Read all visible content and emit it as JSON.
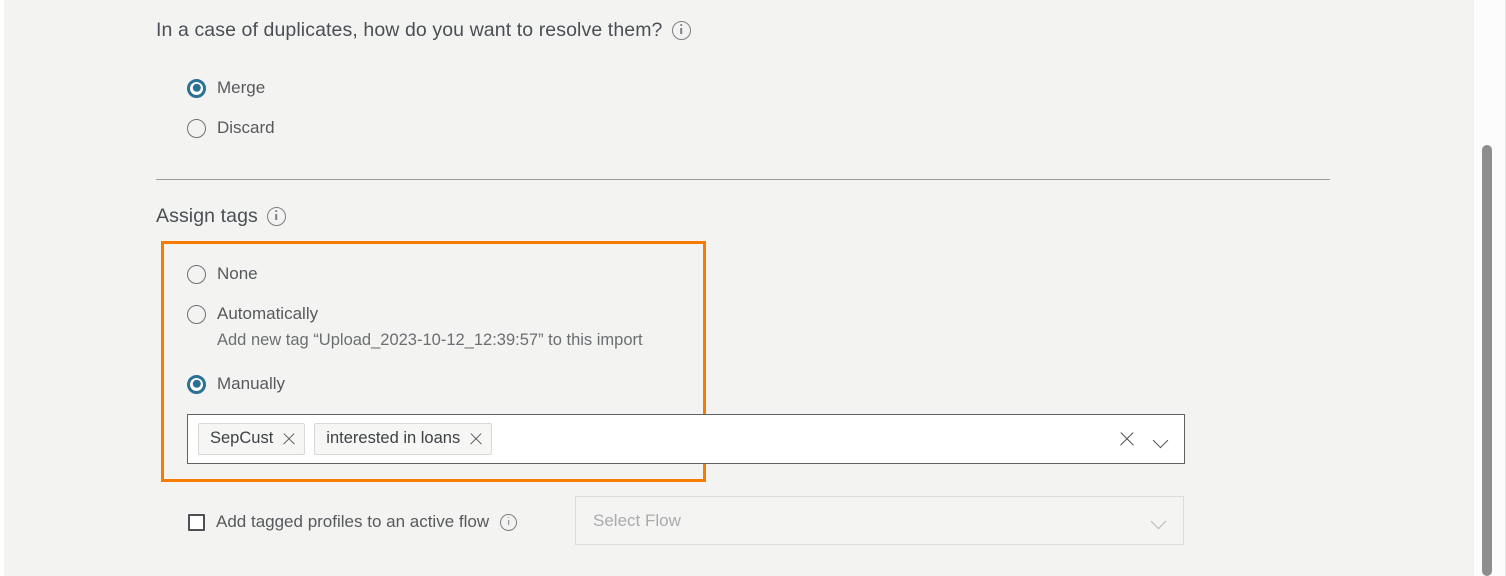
{
  "duplicates": {
    "question": "In a case of duplicates, how do you want to resolve them?",
    "info_icon": "info-icon",
    "options": [
      {
        "label": "Merge",
        "selected": true
      },
      {
        "label": "Discard",
        "selected": false
      }
    ]
  },
  "assign_tags": {
    "heading": "Assign tags",
    "info_icon": "info-icon",
    "options": [
      {
        "label": "None",
        "selected": false
      },
      {
        "label": "Automatically",
        "selected": false
      },
      {
        "label": "Manually",
        "selected": true
      }
    ],
    "automatic_note": "Add new tag “Upload_2023-10-12_12:39:57” to this import",
    "tag_input": {
      "chips": [
        {
          "label": "SepCust",
          "remove_icon": "close-icon"
        },
        {
          "label": "interested in loans",
          "remove_icon": "close-icon"
        }
      ],
      "clear_icon": "close-icon",
      "dropdown_icon": "chevron-down-icon"
    },
    "highlight_color": "#f57c00"
  },
  "active_flow": {
    "checkbox_label": "Add tagged profiles to an active flow",
    "checked": false,
    "info_icon": "info-icon",
    "select_placeholder": "Select Flow",
    "select_disabled": true,
    "dropdown_icon": "chevron-down-icon"
  },
  "theme": {
    "page_background": "#f3f3f1",
    "accent": "#2b7095",
    "text": "#56595d",
    "highlight": "#f57c00"
  }
}
